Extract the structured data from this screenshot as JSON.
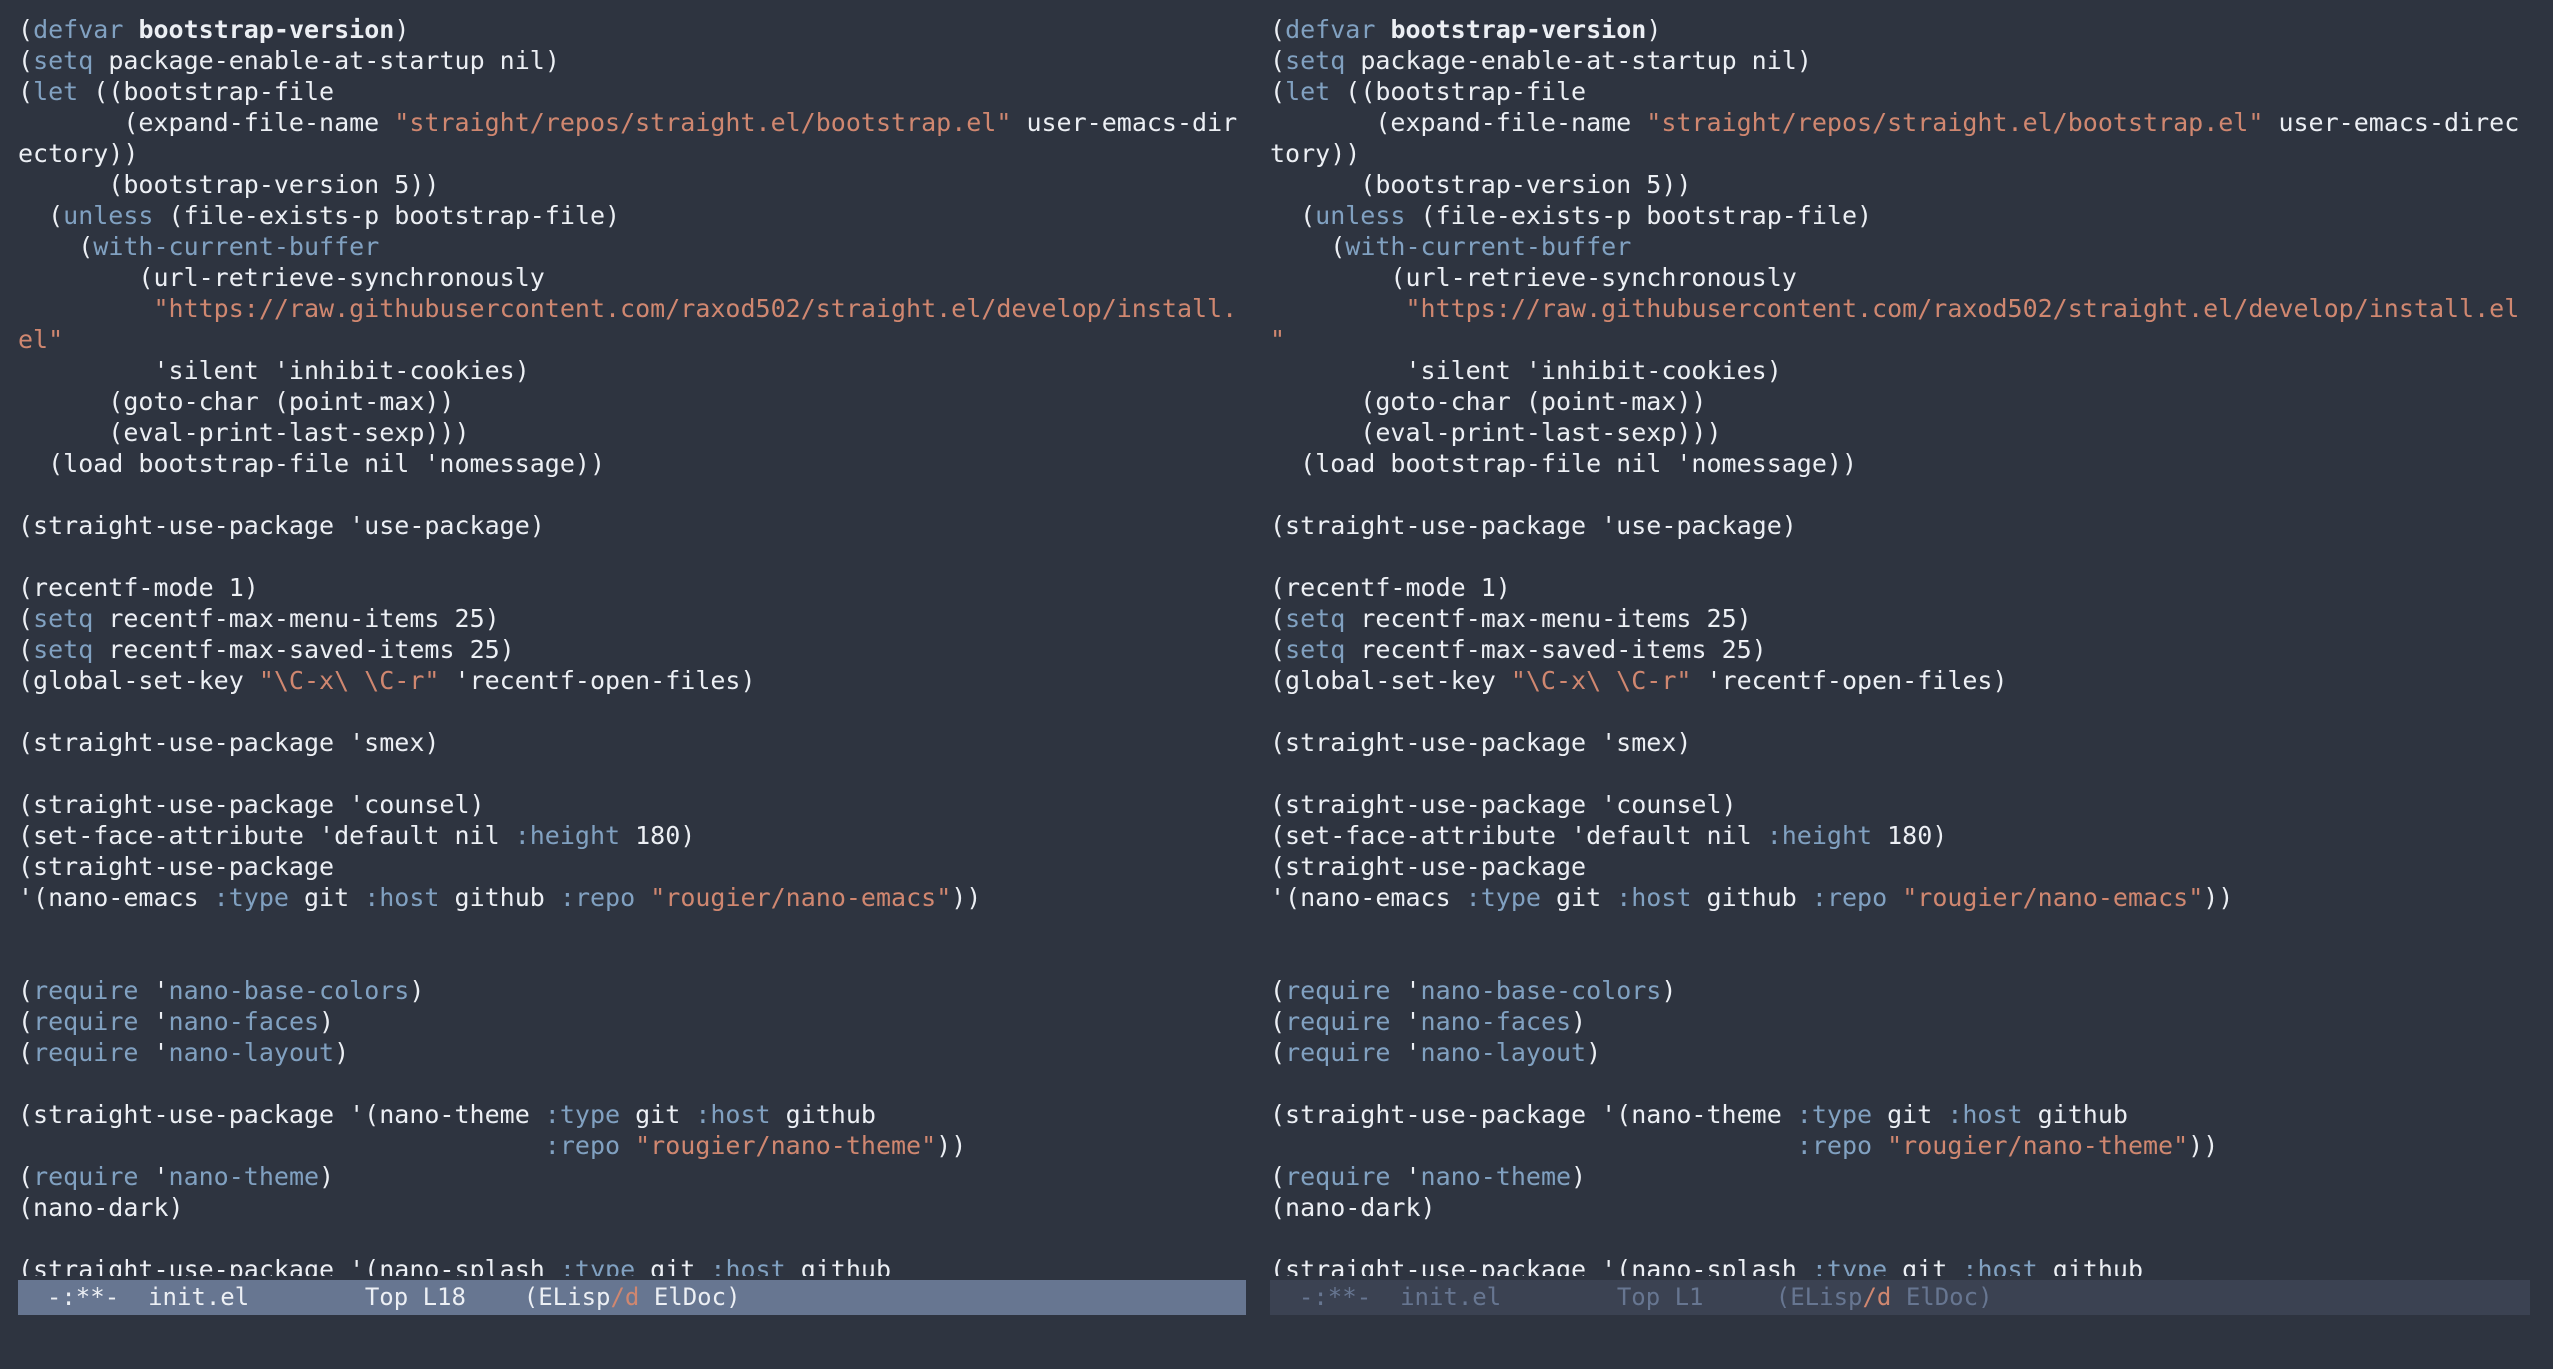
{
  "colors": {
    "background": "#2e3440",
    "foreground": "#eceff4",
    "keyword": "#81a1c1",
    "string": "#d08770",
    "modeline_active_bg": "#677691",
    "modeline_inactive_bg": "#3b4252",
    "modeline_inactive_fg": "#677691"
  },
  "windows": [
    {
      "lines": [
        [
          [
            "p",
            "("
          ],
          [
            "k",
            "defvar"
          ],
          [
            "p",
            " "
          ],
          [
            "b",
            "bootstrap-version"
          ],
          [
            "p",
            ")"
          ]
        ],
        [
          [
            "p",
            "("
          ],
          [
            "k",
            "setq"
          ],
          [
            "p",
            " package-enable-at-startup nil)"
          ]
        ],
        [
          [
            "p",
            "("
          ],
          [
            "k",
            "let"
          ],
          [
            "p",
            " ((bootstrap-file"
          ]
        ],
        [
          [
            "p",
            "       (expand-file-name "
          ],
          [
            "s",
            "\"straight/repos/straight.el/bootstrap.el\""
          ],
          [
            "p",
            " user-emacs-dir"
          ]
        ],
        [
          [
            "p",
            "ectory))"
          ]
        ],
        [
          [
            "p",
            "      (bootstrap-version 5))"
          ]
        ],
        [
          [
            "p",
            "  ("
          ],
          [
            "k",
            "unless"
          ],
          [
            "p",
            " (file-exists-p bootstrap-file)"
          ]
        ],
        [
          [
            "p",
            "    ("
          ],
          [
            "k",
            "with-current-buffer"
          ]
        ],
        [
          [
            "p",
            "        (url-retrieve-synchronously"
          ]
        ],
        [
          [
            "p",
            "         "
          ],
          [
            "s",
            "\"https://raw.githubusercontent.com/raxod502/straight.el/develop/install."
          ]
        ],
        [
          [
            "s",
            "el\""
          ]
        ],
        [
          [
            "p",
            "         'silent 'inhibit-cookies)"
          ]
        ],
        [
          [
            "p",
            "      (goto-char (point-max))"
          ]
        ],
        [
          [
            "p",
            "      (eval-print-last-sexp)))"
          ]
        ],
        [
          [
            "p",
            "  (load bootstrap-file nil 'nomessage))"
          ]
        ],
        [],
        [
          [
            "p",
            "(straight-use-package 'use-package)"
          ]
        ],
        [],
        [
          [
            "p",
            "(recentf-mode 1)"
          ]
        ],
        [
          [
            "p",
            "("
          ],
          [
            "k",
            "setq"
          ],
          [
            "p",
            " recentf-max-menu-items 25)"
          ]
        ],
        [
          [
            "p",
            "("
          ],
          [
            "k",
            "setq"
          ],
          [
            "p",
            " recentf-max-saved-items 25)"
          ]
        ],
        [
          [
            "p",
            "(global-set-key "
          ],
          [
            "s",
            "\"\\C-x\\ \\C-r\""
          ],
          [
            "p",
            " 'recentf-open-files)"
          ]
        ],
        [],
        [
          [
            "p",
            "(straight-use-package 'smex)"
          ]
        ],
        [],
        [
          [
            "p",
            "(straight-use-package 'counsel)"
          ]
        ],
        [
          [
            "p",
            "(set-face-attribute 'default nil "
          ],
          [
            "k",
            ":height"
          ],
          [
            "p",
            " 180)"
          ]
        ],
        [
          [
            "p",
            "(straight-use-package"
          ]
        ],
        [
          [
            "p",
            "'(nano-emacs "
          ],
          [
            "k",
            ":type"
          ],
          [
            "p",
            " git "
          ],
          [
            "k",
            ":host"
          ],
          [
            "p",
            " github "
          ],
          [
            "k",
            ":repo"
          ],
          [
            "p",
            " "
          ],
          [
            "s",
            "\"rougier/nano-emacs\""
          ],
          [
            "p",
            "))"
          ]
        ],
        [],
        [],
        [
          [
            "p",
            "("
          ],
          [
            "k",
            "require"
          ],
          [
            "p",
            " '"
          ],
          [
            "k",
            "nano-base-colors"
          ],
          [
            "p",
            ")"
          ]
        ],
        [
          [
            "p",
            "("
          ],
          [
            "k",
            "require"
          ],
          [
            "p",
            " '"
          ],
          [
            "k",
            "nano-faces"
          ],
          [
            "p",
            ")"
          ]
        ],
        [
          [
            "p",
            "("
          ],
          [
            "k",
            "require"
          ],
          [
            "p",
            " '"
          ],
          [
            "k",
            "nano-layout"
          ],
          [
            "p",
            ")"
          ]
        ],
        [],
        [
          [
            "p",
            "(straight-use-package '(nano-theme "
          ],
          [
            "k",
            ":type"
          ],
          [
            "p",
            " git "
          ],
          [
            "k",
            ":host"
          ],
          [
            "p",
            " github"
          ]
        ],
        [
          [
            "p",
            "                                   "
          ],
          [
            "k",
            ":repo"
          ],
          [
            "p",
            " "
          ],
          [
            "s",
            "\"rougier/nano-theme\""
          ],
          [
            "p",
            "))"
          ]
        ],
        [
          [
            "p",
            "("
          ],
          [
            "k",
            "require"
          ],
          [
            "p",
            " '"
          ],
          [
            "k",
            "nano-theme"
          ],
          [
            "p",
            ")"
          ]
        ],
        [
          [
            "p",
            "(nano-dark)"
          ]
        ],
        [],
        [
          [
            "p",
            "(straight-use-package '(nano-splash "
          ],
          [
            "k",
            ":type"
          ],
          [
            "p",
            " git "
          ],
          [
            "k",
            ":host"
          ],
          [
            "p",
            " github"
          ]
        ]
      ],
      "modeline": {
        "active": true,
        "state": "-:**-",
        "buffer": "init.el",
        "position": "Top L18",
        "mode_open": "(ELisp",
        "mode_slash_d": "/d",
        "mode_close": " ElDoc)"
      }
    },
    {
      "lines": [
        [
          [
            "p",
            "("
          ],
          [
            "k",
            "defvar"
          ],
          [
            "p",
            " "
          ],
          [
            "b",
            "bootstrap-version"
          ],
          [
            "p",
            ")"
          ]
        ],
        [
          [
            "p",
            "("
          ],
          [
            "k",
            "setq"
          ],
          [
            "p",
            " package-enable-at-startup nil)"
          ]
        ],
        [
          [
            "p",
            "("
          ],
          [
            "k",
            "let"
          ],
          [
            "p",
            " ((bootstrap-file"
          ]
        ],
        [
          [
            "p",
            "       (expand-file-name "
          ],
          [
            "s",
            "\"straight/repos/straight.el/bootstrap.el\""
          ],
          [
            "p",
            " user-emacs-direc"
          ]
        ],
        [
          [
            "p",
            "tory))"
          ]
        ],
        [
          [
            "p",
            "      (bootstrap-version 5))"
          ]
        ],
        [
          [
            "p",
            "  ("
          ],
          [
            "k",
            "unless"
          ],
          [
            "p",
            " (file-exists-p bootstrap-file)"
          ]
        ],
        [
          [
            "p",
            "    ("
          ],
          [
            "k",
            "with-current-buffer"
          ]
        ],
        [
          [
            "p",
            "        (url-retrieve-synchronously"
          ]
        ],
        [
          [
            "p",
            "         "
          ],
          [
            "s",
            "\"https://raw.githubusercontent.com/raxod502/straight.el/develop/install.el"
          ]
        ],
        [
          [
            "s",
            "\""
          ]
        ],
        [
          [
            "p",
            "         'silent 'inhibit-cookies)"
          ]
        ],
        [
          [
            "p",
            "      (goto-char (point-max))"
          ]
        ],
        [
          [
            "p",
            "      (eval-print-last-sexp)))"
          ]
        ],
        [
          [
            "p",
            "  (load bootstrap-file nil 'nomessage))"
          ]
        ],
        [],
        [
          [
            "p",
            "(straight-use-package 'use-package)"
          ]
        ],
        [],
        [
          [
            "p",
            "(recentf-mode 1)"
          ]
        ],
        [
          [
            "p",
            "("
          ],
          [
            "k",
            "setq"
          ],
          [
            "p",
            " recentf-max-menu-items 25)"
          ]
        ],
        [
          [
            "p",
            "("
          ],
          [
            "k",
            "setq"
          ],
          [
            "p",
            " recentf-max-saved-items 25)"
          ]
        ],
        [
          [
            "p",
            "(global-set-key "
          ],
          [
            "s",
            "\"\\C-x\\ \\C-r\""
          ],
          [
            "p",
            " 'recentf-open-files)"
          ]
        ],
        [],
        [
          [
            "p",
            "(straight-use-package 'smex)"
          ]
        ],
        [],
        [
          [
            "p",
            "(straight-use-package 'counsel)"
          ]
        ],
        [
          [
            "p",
            "(set-face-attribute 'default nil "
          ],
          [
            "k",
            ":height"
          ],
          [
            "p",
            " 180)"
          ]
        ],
        [
          [
            "p",
            "(straight-use-package"
          ]
        ],
        [
          [
            "p",
            "'(nano-emacs "
          ],
          [
            "k",
            ":type"
          ],
          [
            "p",
            " git "
          ],
          [
            "k",
            ":host"
          ],
          [
            "p",
            " github "
          ],
          [
            "k",
            ":repo"
          ],
          [
            "p",
            " "
          ],
          [
            "s",
            "\"rougier/nano-emacs\""
          ],
          [
            "p",
            "))"
          ]
        ],
        [],
        [],
        [
          [
            "p",
            "("
          ],
          [
            "k",
            "require"
          ],
          [
            "p",
            " '"
          ],
          [
            "k",
            "nano-base-colors"
          ],
          [
            "p",
            ")"
          ]
        ],
        [
          [
            "p",
            "("
          ],
          [
            "k",
            "require"
          ],
          [
            "p",
            " '"
          ],
          [
            "k",
            "nano-faces"
          ],
          [
            "p",
            ")"
          ]
        ],
        [
          [
            "p",
            "("
          ],
          [
            "k",
            "require"
          ],
          [
            "p",
            " '"
          ],
          [
            "k",
            "nano-layout"
          ],
          [
            "p",
            ")"
          ]
        ],
        [],
        [
          [
            "p",
            "(straight-use-package '(nano-theme "
          ],
          [
            "k",
            ":type"
          ],
          [
            "p",
            " git "
          ],
          [
            "k",
            ":host"
          ],
          [
            "p",
            " github"
          ]
        ],
        [
          [
            "p",
            "                                   "
          ],
          [
            "k",
            ":repo"
          ],
          [
            "p",
            " "
          ],
          [
            "s",
            "\"rougier/nano-theme\""
          ],
          [
            "p",
            "))"
          ]
        ],
        [
          [
            "p",
            "("
          ],
          [
            "k",
            "require"
          ],
          [
            "p",
            " '"
          ],
          [
            "k",
            "nano-theme"
          ],
          [
            "p",
            ")"
          ]
        ],
        [
          [
            "p",
            "(nano-dark)"
          ]
        ],
        [],
        [
          [
            "p",
            "(straight-use-package '(nano-splash "
          ],
          [
            "k",
            ":type"
          ],
          [
            "p",
            " git "
          ],
          [
            "k",
            ":host"
          ],
          [
            "p",
            " github"
          ]
        ]
      ],
      "modeline": {
        "active": false,
        "state": "-:**-",
        "buffer": "init.el",
        "position": "Top L1",
        "mode_open": "(ELisp",
        "mode_slash_d": "/d",
        "mode_close": " ElDoc)"
      }
    }
  ]
}
